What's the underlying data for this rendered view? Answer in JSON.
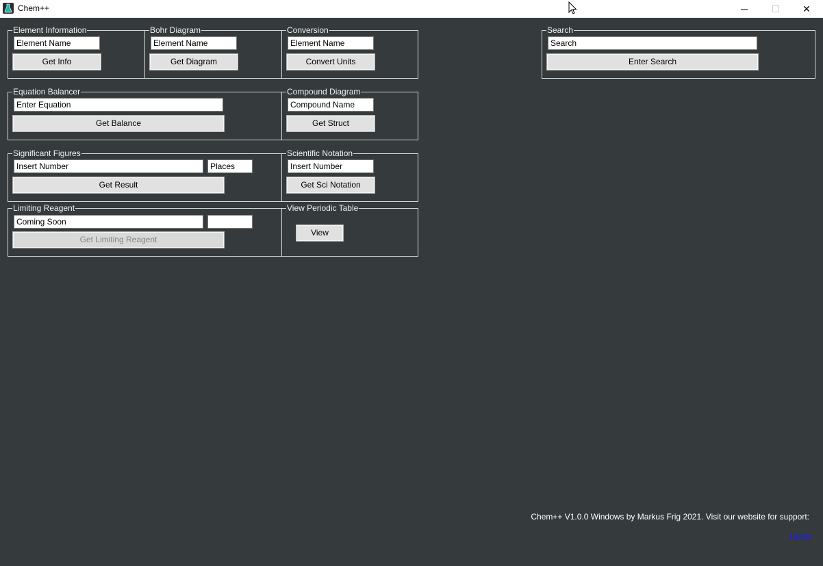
{
  "window": {
    "title": "Chem++",
    "min_symbol": "─",
    "max_symbol": "☐",
    "close_symbol": "✕"
  },
  "groups": {
    "element_info": {
      "legend": "Element Information",
      "input": "Element Name",
      "button": "Get Info"
    },
    "bohr": {
      "legend": "Bohr Diagram",
      "input": "Element Name",
      "button": "Get Diagram"
    },
    "conversion": {
      "legend": "Conversion",
      "input": "Element Name",
      "button": "Convert Units"
    },
    "search": {
      "legend": "Search",
      "input": "Search",
      "button": "Enter Search"
    },
    "equation": {
      "legend": "Equation Balancer",
      "input": "Enter Equation",
      "button": "Get Balance"
    },
    "compound": {
      "legend": "Compound Diagram",
      "input": "Compound Name",
      "button": "Get Struct"
    },
    "sigfig": {
      "legend": "Significant Figures",
      "input": "Insert Number",
      "places": "Places",
      "button": "Get Result"
    },
    "scinot": {
      "legend": "Scientific Notation",
      "input": "Insert Number",
      "button": "Get Sci Notation"
    },
    "limiting": {
      "legend": "Limiting Reagent",
      "input": "Coming Soon",
      "input2": "",
      "button": "Get Limiting Reagent"
    },
    "periodic": {
      "legend": "View Periodic Table",
      "button": "View"
    }
  },
  "footer": {
    "text": "Chem++ V1.0.0 Windows by Markus Frig 2021. Visit our website for support:",
    "link": "HERE"
  },
  "icons": {
    "app": "flask-icon",
    "cursor": "mouse-pointer-icon"
  },
  "colors": {
    "background": "#353b3c",
    "link": "#1a1aff"
  }
}
